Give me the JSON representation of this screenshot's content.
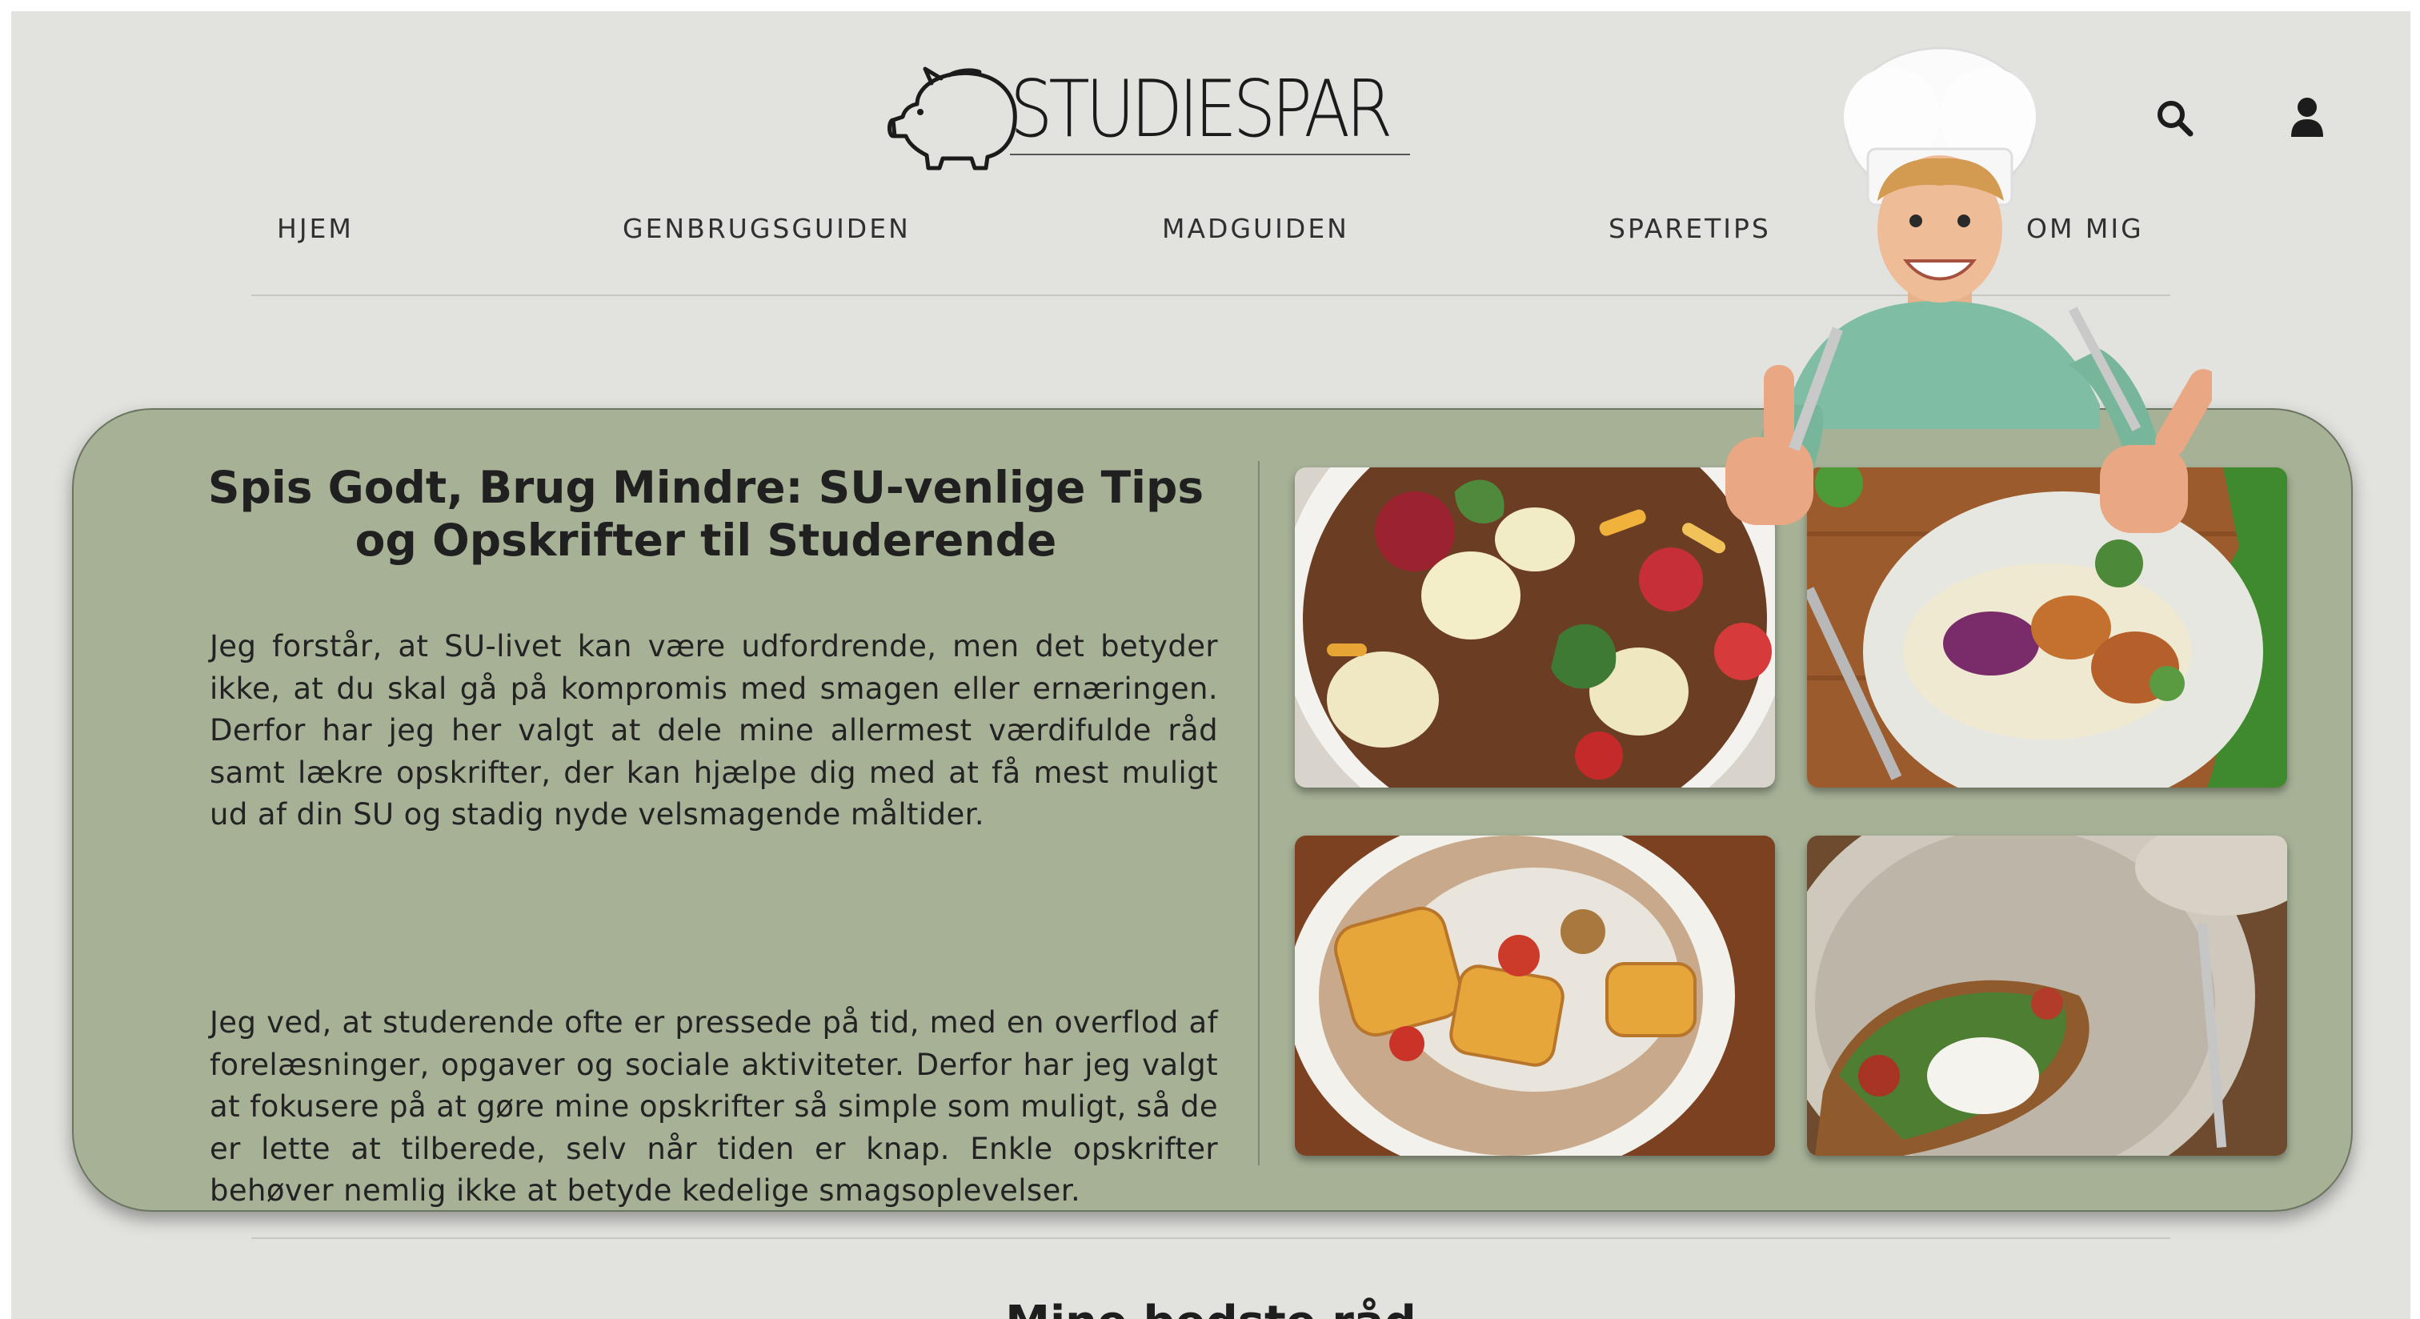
{
  "header": {
    "logo_text": "STUDIESPAR",
    "icons": {
      "search": "search-icon",
      "account": "user-icon"
    }
  },
  "nav": {
    "items": [
      {
        "label": "HJEM"
      },
      {
        "label": "GENBRUGSGUIDEN"
      },
      {
        "label": "MADGUIDEN"
      },
      {
        "label": "SPARETIPS"
      },
      {
        "label": "OM MIG"
      }
    ]
  },
  "hero": {
    "title": "Spis Godt, Brug Mindre: SU-venlige Tips og Opskrifter til Studerende",
    "paragraph_1": "Jeg forstår, at SU-livet kan være udfordrende, men det betyder ikke, at du skal gå på kompromis med smagen eller ernæringen. Derfor har jeg her valgt at dele mine allermest værdifulde råd samt lækre opskrifter, der kan hjælpe dig med at få mest muligt ud af din SU og stadig nyde velsmagende måltider.",
    "paragraph_2": "Jeg ved, at studerende ofte er pressede på tid, med en overflod af forelæsninger, opgaver og sociale aktiviteter. Derfor har jeg valgt at fokusere på at gøre mine opskrifter så simple som muligt, så de er lette at tilberede, selv når tiden er knap. Enkle opskrifter behøver nemlig ikke at betyde kedelige smagsoplevelser.",
    "photos": [
      {
        "icon": "bowl-photo"
      },
      {
        "icon": "plate-photo"
      },
      {
        "icon": "wrap-photo"
      },
      {
        "icon": "toast-photo"
      }
    ]
  },
  "section": {
    "title": "Mine bedste råd"
  },
  "colors": {
    "page_bg": "#e2e3df",
    "card_bg": "#a6b196",
    "text": "#2a2a2a"
  }
}
